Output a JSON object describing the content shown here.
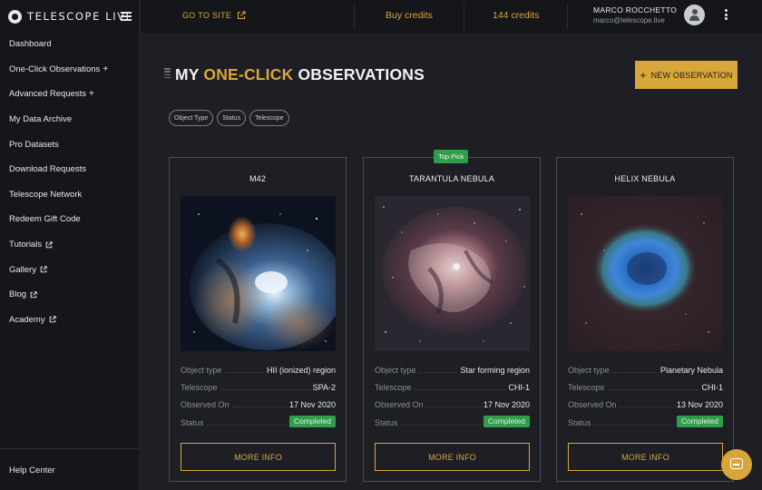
{
  "brand": {
    "name": "TELESCOPE LIVE"
  },
  "sidebar": {
    "items": [
      {
        "label": "Dashboard",
        "suffix": "",
        "external": false
      },
      {
        "label": "One-Click Observations",
        "suffix": "+",
        "external": false
      },
      {
        "label": "Advanced Requests",
        "suffix": "+",
        "external": false
      },
      {
        "label": "My Data Archive",
        "suffix": "",
        "external": false
      },
      {
        "label": "Pro Datasets",
        "suffix": "",
        "external": false
      },
      {
        "label": "Download Requests",
        "suffix": "",
        "external": false
      },
      {
        "label": "Telescope Network",
        "suffix": "",
        "external": false
      },
      {
        "label": "Redeem Gift Code",
        "suffix": "",
        "external": false
      },
      {
        "label": "Tutorials",
        "suffix": "",
        "external": true
      },
      {
        "label": "Gallery",
        "suffix": "",
        "external": true
      },
      {
        "label": "Blog",
        "suffix": "",
        "external": true
      },
      {
        "label": "Academy",
        "suffix": "",
        "external": true
      }
    ],
    "help_label": "Help Center"
  },
  "topbar": {
    "goto_label": "GO TO SITE",
    "buy_credits_label": "Buy credits",
    "credits_label": "144 credits",
    "user_name": "MARCO ROCCHETTO",
    "user_email": "marco@telescope.live"
  },
  "page": {
    "title_prefix": "MY",
    "title_accent": "ONE-CLICK",
    "title_suffix": "OBSERVATIONS",
    "new_button_label": "NEW OBSERVATION",
    "filters": [
      "Object Type",
      "Status",
      "Telescope"
    ]
  },
  "labels": {
    "object_type": "Object type",
    "telescope": "Telescope",
    "observed_on": "Observed On",
    "status": "Status",
    "more_info": "MORE INFO",
    "top_pick": "Top Pick"
  },
  "cards": [
    {
      "title": "M42",
      "object_type": "HII (ionized) region",
      "telescope": "SPA-2",
      "observed_on": "17 Nov 2020",
      "status": "Completed"
    },
    {
      "title": "TARANTULA NEBULA",
      "object_type": "Star forming region",
      "telescope": "CHI-1",
      "observed_on": "17 Nov 2020",
      "status": "Completed"
    },
    {
      "title": "HELIX NEBULA",
      "object_type": "Planetary Nebula",
      "telescope": "CHI-1",
      "observed_on": "13 Nov 2020",
      "status": "Completed"
    }
  ],
  "colors": {
    "accent": "#d9a63a",
    "status_green": "#2e9e4b",
    "background": "#1d1f24",
    "sidebar": "#14161a"
  },
  "icons": {
    "menu": "hamburger-icon",
    "external": "external-link-icon",
    "avatar": "user-icon",
    "more": "kebab-icon",
    "chat": "chat-icon"
  }
}
